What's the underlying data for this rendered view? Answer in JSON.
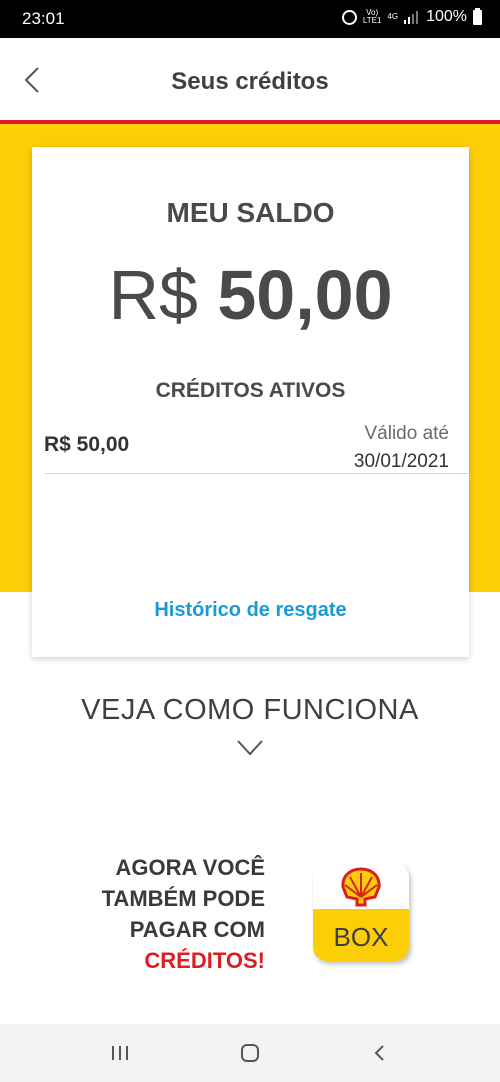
{
  "status_bar": {
    "time": "23:01",
    "network_top": "Vo)",
    "network_bottom": "LTE1",
    "network_type": "4G",
    "battery": "100%"
  },
  "header": {
    "title": "Seus créditos",
    "back_icon": "chevron-left-icon"
  },
  "balance_card": {
    "label": "MEU SALDO",
    "currency": "R$",
    "amount": "50,00",
    "active_credits_label": "CRÉDITOS ATIVOS",
    "credits": [
      {
        "amount": "R$ 50,00",
        "valid_label": "Válido até",
        "valid_date": "30/01/2021"
      }
    ],
    "history_link": "Histórico de resgate"
  },
  "how_it_works": {
    "title": "VEJA COMO FUNCIONA",
    "icon": "chevron-down-icon"
  },
  "promo": {
    "lines": [
      "AGORA VOCÊ",
      "TAMBÉM PODE",
      "PAGAR COM"
    ],
    "highlight": "CRÉDITOS!",
    "app_label": "BOX",
    "logo": "shell-logo"
  },
  "colors": {
    "brand_yellow": "#fbce07",
    "brand_red": "#dd1d21",
    "link_blue": "#1a9bd7",
    "text_dark": "#404040"
  }
}
